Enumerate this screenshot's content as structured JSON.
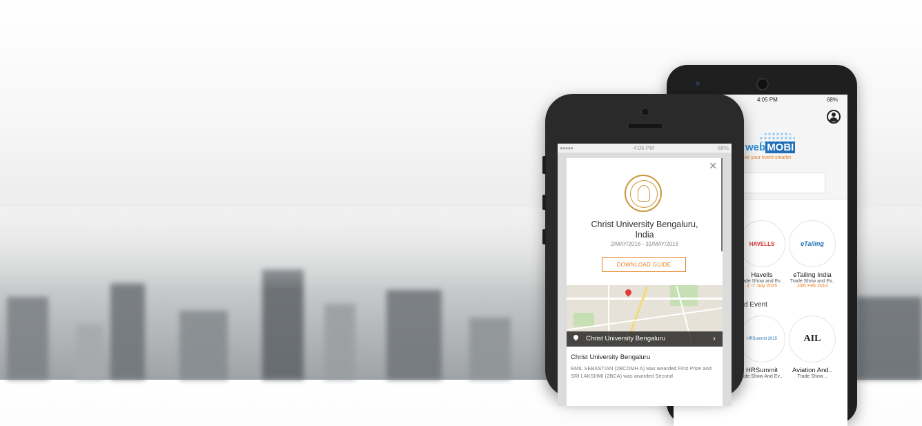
{
  "android": {
    "status": {
      "time": "4:05 PM",
      "battery": "68%"
    },
    "logo": {
      "web": "web",
      "mobi": "MOBI",
      "tagline": "ke your event smarter"
    },
    "section_label": "d Event",
    "events_row1": [
      {
        "logo_text": "HAVELLS",
        "name": "Havells",
        "sub": "rade Show and Ev..",
        "date": "2 -7 July 2015"
      },
      {
        "logo_text": "eTailing",
        "name": "eTailing India",
        "sub": "Trade Show and Ev..",
        "date": "10th Feb 2014"
      }
    ],
    "events_row2": [
      {
        "logo_text": "HRSummit 2015",
        "name": "HRSummit",
        "sub": "ade Show And Ev.."
      },
      {
        "logo_text": "AIL",
        "name": "Aviation And..",
        "sub": "Trade Show .."
      }
    ]
  },
  "iphone": {
    "status": {
      "signal": "●●●●● ",
      "time": "4:05 PM",
      "battery": "68%"
    },
    "modal": {
      "close": "✕",
      "title_line1": "Christ University Bengaluru,",
      "title_line2": "India",
      "dates": "2/MAY/2016 - 31/MAY/2016",
      "download_label": "DOWNLOAD GUIDE",
      "map_label": "Christ University Bengaluru",
      "map_chevron": "›",
      "venue_title": "Christ University Bengaluru",
      "venue_desc": "EMIL SEBASTIAN (2BCOMH A) was awarded First Prize and SRI LAKSHMI (2BCA) was awarded Second"
    }
  }
}
